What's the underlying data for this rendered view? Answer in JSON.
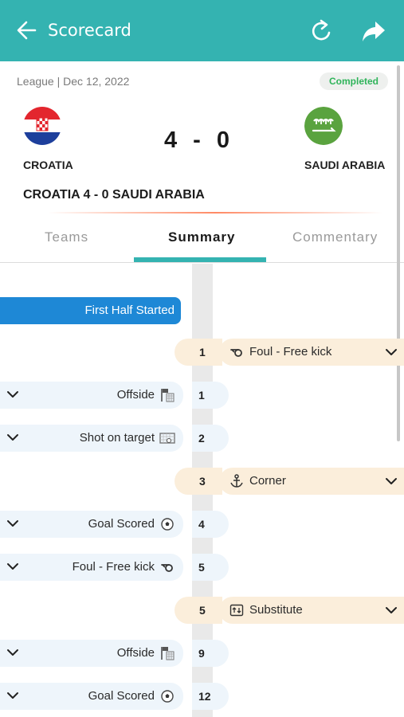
{
  "appbar": {
    "title": "Scorecard"
  },
  "match": {
    "meta": "League | Dec 12, 2022",
    "status": "Completed",
    "home_team": "CROATIA",
    "away_team": "SAUDI ARABIA",
    "home_score": "4",
    "separator": "-",
    "away_score": "0",
    "result": "CROATIA 4 - 0 SAUDI ARABIA"
  },
  "tabs": [
    {
      "label": "Teams",
      "active": false
    },
    {
      "label": "Summary",
      "active": true
    },
    {
      "label": "Commentary",
      "active": false
    }
  ],
  "timeline": {
    "phase": "First Half Started",
    "events": [
      {
        "side": "away",
        "minute": "1",
        "label": "Foul - Free kick",
        "icon": "whistle-icon"
      },
      {
        "side": "home",
        "minute": "1",
        "label": "Offside",
        "icon": "offside-flag-icon"
      },
      {
        "side": "home",
        "minute": "2",
        "label": "Shot on target",
        "icon": "goal-net-icon"
      },
      {
        "side": "away",
        "minute": "3",
        "label": "Corner",
        "icon": "corner-anchor-icon"
      },
      {
        "side": "home",
        "minute": "4",
        "label": "Goal Scored",
        "icon": "ball-icon"
      },
      {
        "side": "home",
        "minute": "5",
        "label": "Foul - Free kick",
        "icon": "whistle-icon"
      },
      {
        "side": "away",
        "minute": "5",
        "label": "Substitute",
        "icon": "substitute-icon"
      },
      {
        "side": "home",
        "minute": "9",
        "label": "Offside",
        "icon": "offside-flag-icon"
      },
      {
        "side": "home",
        "minute": "12",
        "label": "Goal Scored",
        "icon": "ball-icon"
      }
    ]
  },
  "colors": {
    "appbar": "#34b3b1",
    "phase": "#1e88d6",
    "status_text": "#2fb45a",
    "home_event_bg": "#eef5fb",
    "away_event_bg": "#fbeedb"
  }
}
